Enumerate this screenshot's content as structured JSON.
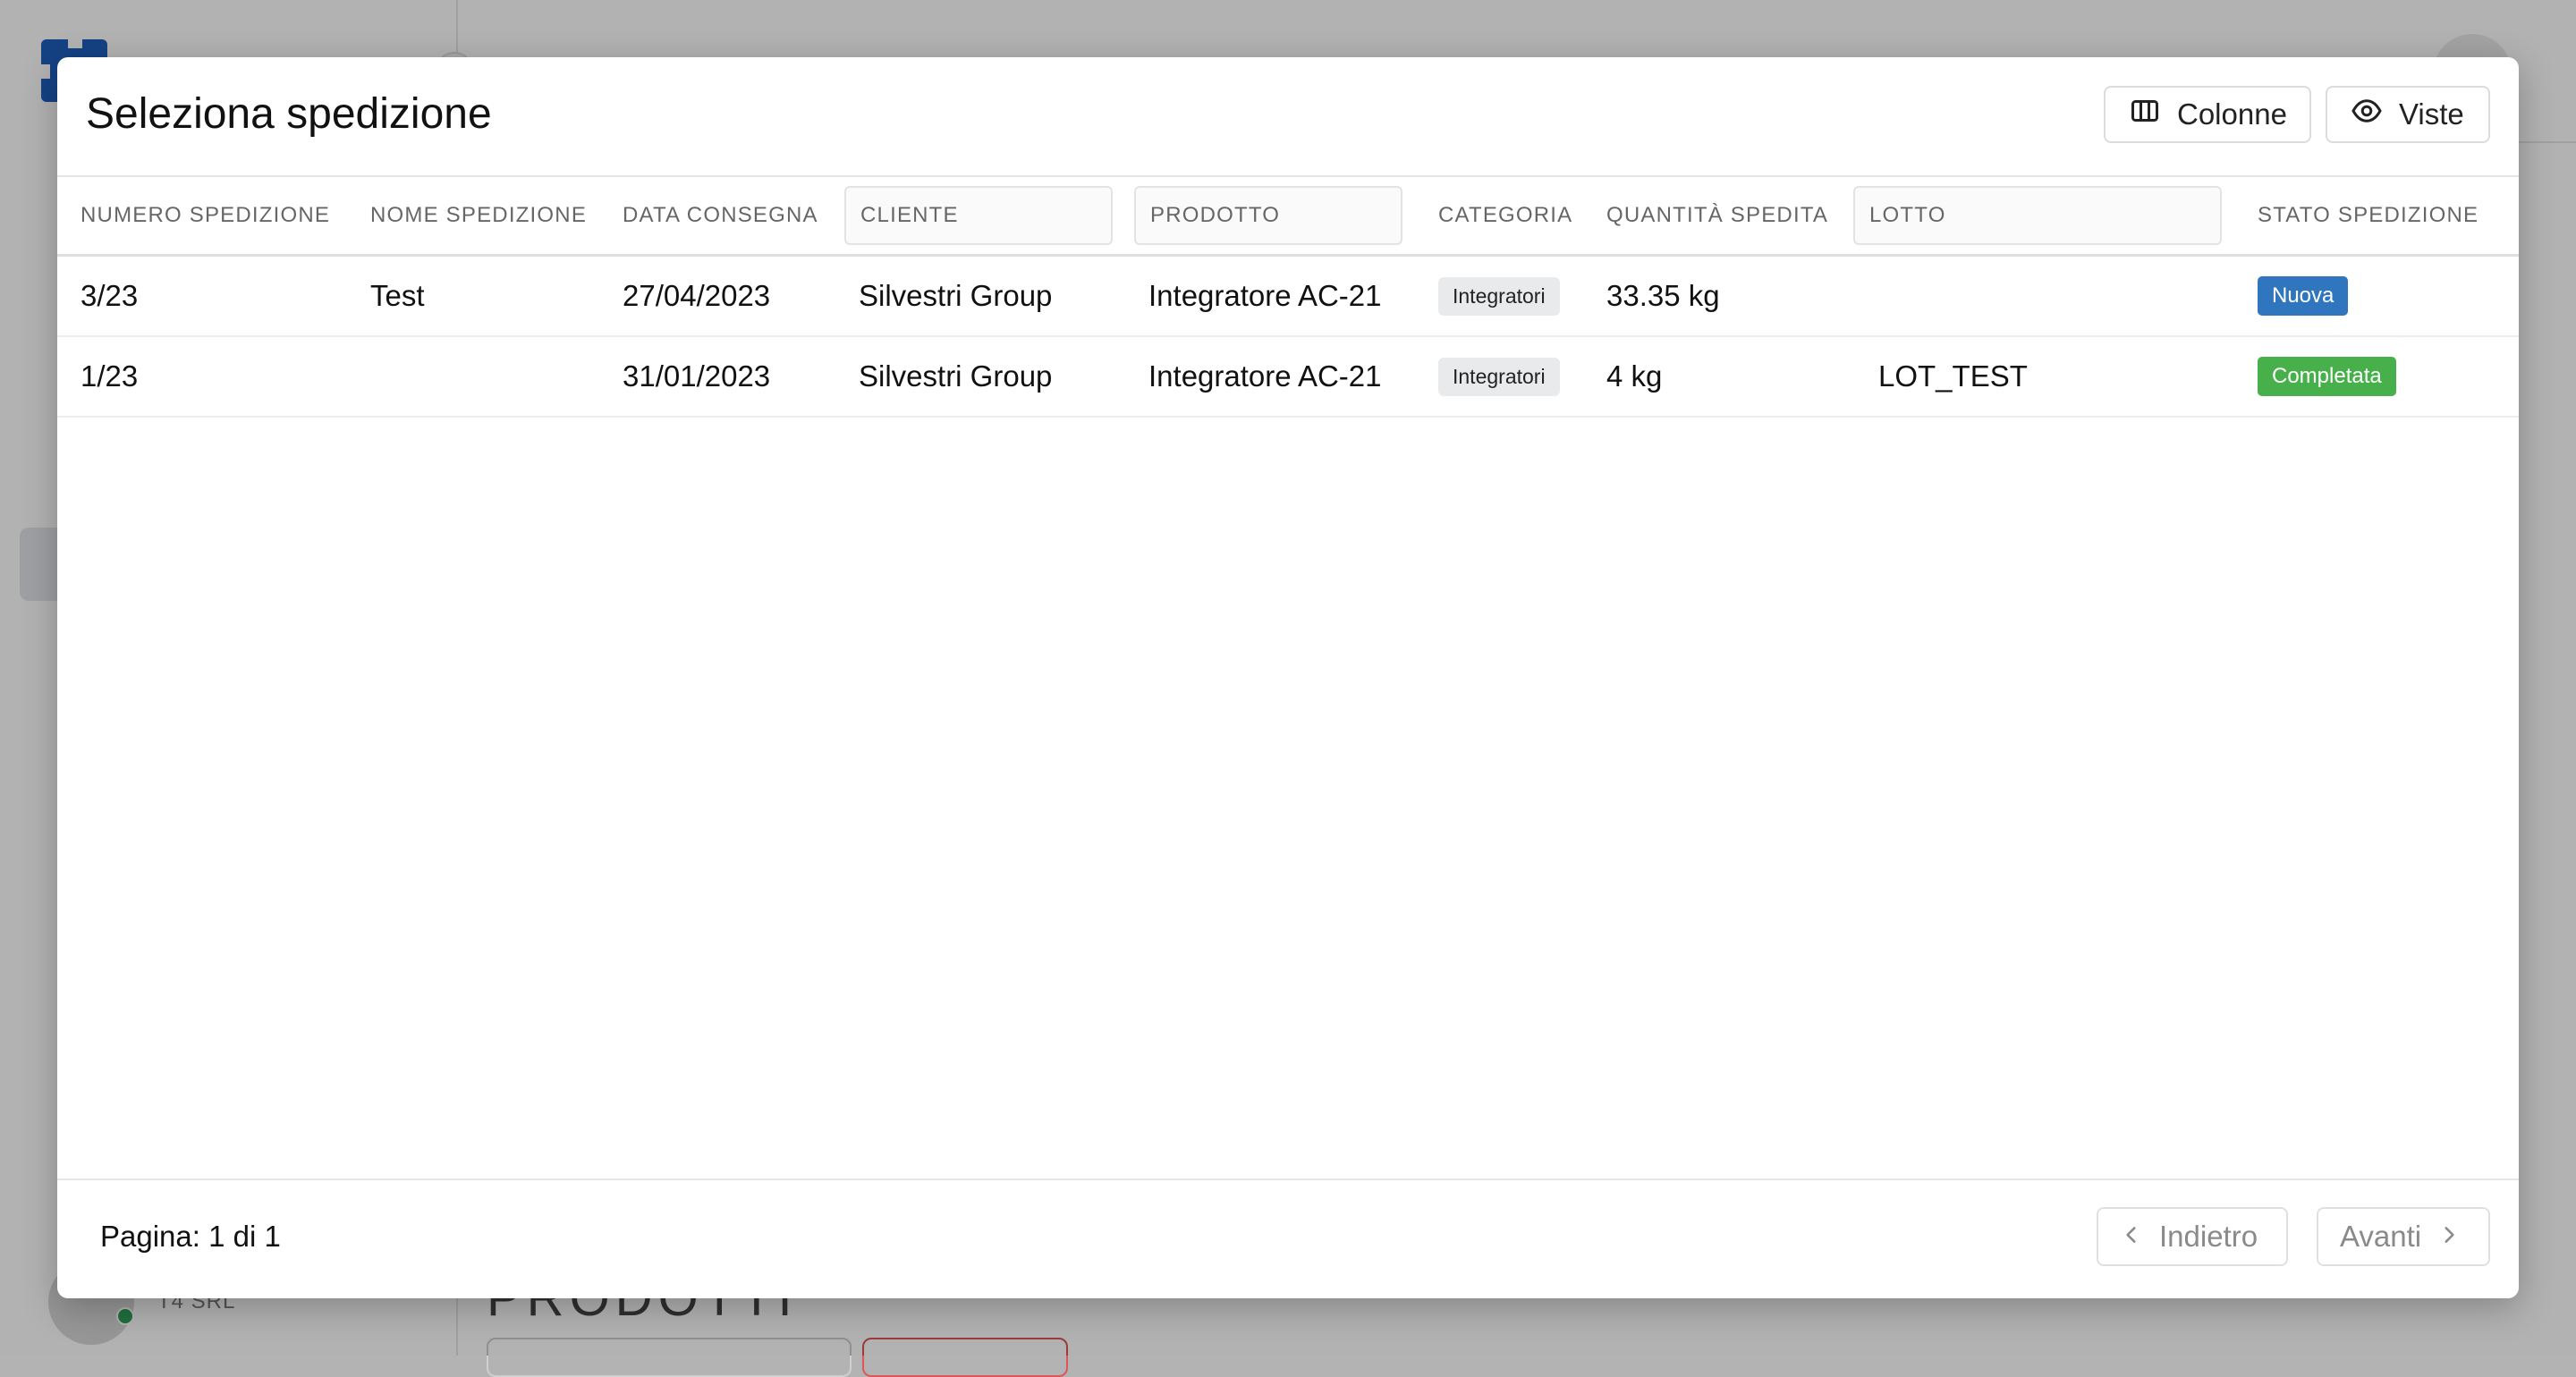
{
  "background": {
    "company_name": "T4 SRL",
    "section_title": "PRODOTTI"
  },
  "modal": {
    "title": "Seleziona spedizione",
    "buttons": {
      "columns": "Colonne",
      "views": "Viste"
    },
    "table": {
      "columns": [
        "NUMERO SPEDIZIONE",
        "NOME SPEDIZIONE",
        "DATA CONSEGNA",
        "CLIENTE",
        "PRODOTTO",
        "CATEGORIA",
        "QUANTITÀ SPEDITA",
        "LOTTO",
        "STATO SPEDIZIONE"
      ],
      "rows": [
        {
          "numero": "3/23",
          "nome": "Test",
          "data": "27/04/2023",
          "cliente": "Silvestri Group",
          "prodotto": "Integratore AC-21",
          "categoria": "Integratori",
          "quantita": "33.35 kg",
          "lotto": "",
          "stato": "Nuova"
        },
        {
          "numero": "1/23",
          "nome": "",
          "data": "31/01/2023",
          "cliente": "Silvestri Group",
          "prodotto": "Integratore AC-21",
          "categoria": "Integratori",
          "quantita": "4 kg",
          "lotto": "LOT_TEST",
          "stato": "Completata"
        }
      ]
    },
    "pagination": {
      "page_info": "Pagina: 1 di 1",
      "prev": "Indietro",
      "next": "Avanti"
    }
  },
  "colors": {
    "status_new": "#2f76bf",
    "status_done": "#47b04b",
    "logo": "#1f5fbf"
  }
}
